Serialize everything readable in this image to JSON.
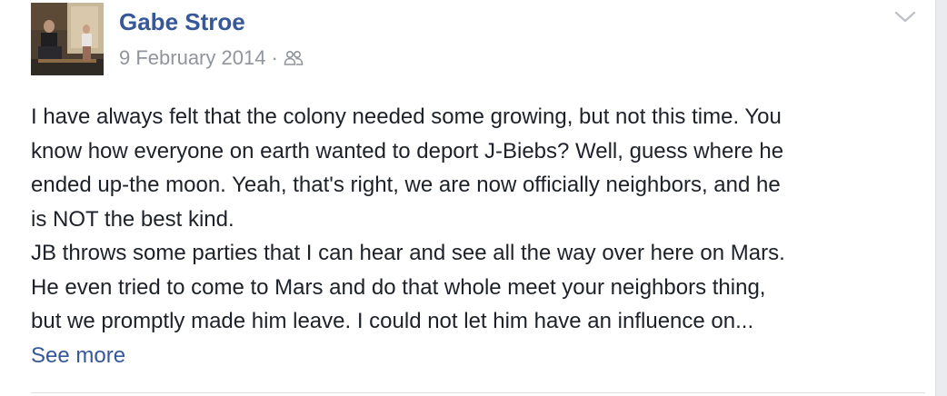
{
  "post": {
    "author": "Gabe Stroe",
    "date": "9 February 2014",
    "separator": "·",
    "audience_icon": "friends-icon",
    "menu_icon": "chevron-down-icon",
    "paragraph_1": "I have always felt that the colony needed some growing, but not this time. You\nknow how everyone on earth wanted to deport J-Biebs? Well, guess where he\nended up-the moon. Yeah, that's right, we are now officially neighbors, and he\nis NOT the best kind.",
    "paragraph_2": "JB throws some parties that I can hear and see all the way over here on Mars.\nHe even tried to come to Mars and do that whole meet your neighbors thing,\nbut we promptly made him leave. I could not let him have an influence on...",
    "see_more": "See more"
  },
  "colors": {
    "link": "#365899",
    "meta": "#90949c",
    "text": "#1d2129",
    "background": "#e9ebee",
    "card": "#ffffff"
  }
}
